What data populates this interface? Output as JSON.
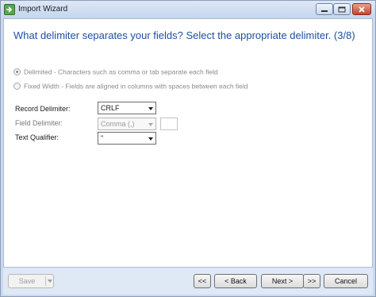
{
  "window": {
    "title": "Import Wizard",
    "icon": "import-wizard-icon"
  },
  "content": {
    "heading": "What delimiter separates your fields? Select the appropriate delimiter. (3/8)",
    "options": [
      {
        "label": "Delimited - Characters such as comma or tab separate each field",
        "selected": true
      },
      {
        "label": "Fixed Width - Fields are aligned in columns with spaces between each field",
        "selected": false
      }
    ],
    "record_delimiter": {
      "label": "Record Delimiter:",
      "value": "CRLF"
    },
    "field_delimiter": {
      "label": "Field Delimiter:",
      "value": "Comma (,)"
    },
    "text_qualifier": {
      "label": "Text Qualifier:",
      "value": "\""
    }
  },
  "footer": {
    "save": "Save",
    "first": "<<",
    "back": "< Back",
    "next": "Next >",
    "last": ">>",
    "cancel": "Cancel"
  },
  "colors": {
    "heading": "#1f4fa3",
    "close_button": "#c4452c",
    "frame": "#c9daf0"
  }
}
